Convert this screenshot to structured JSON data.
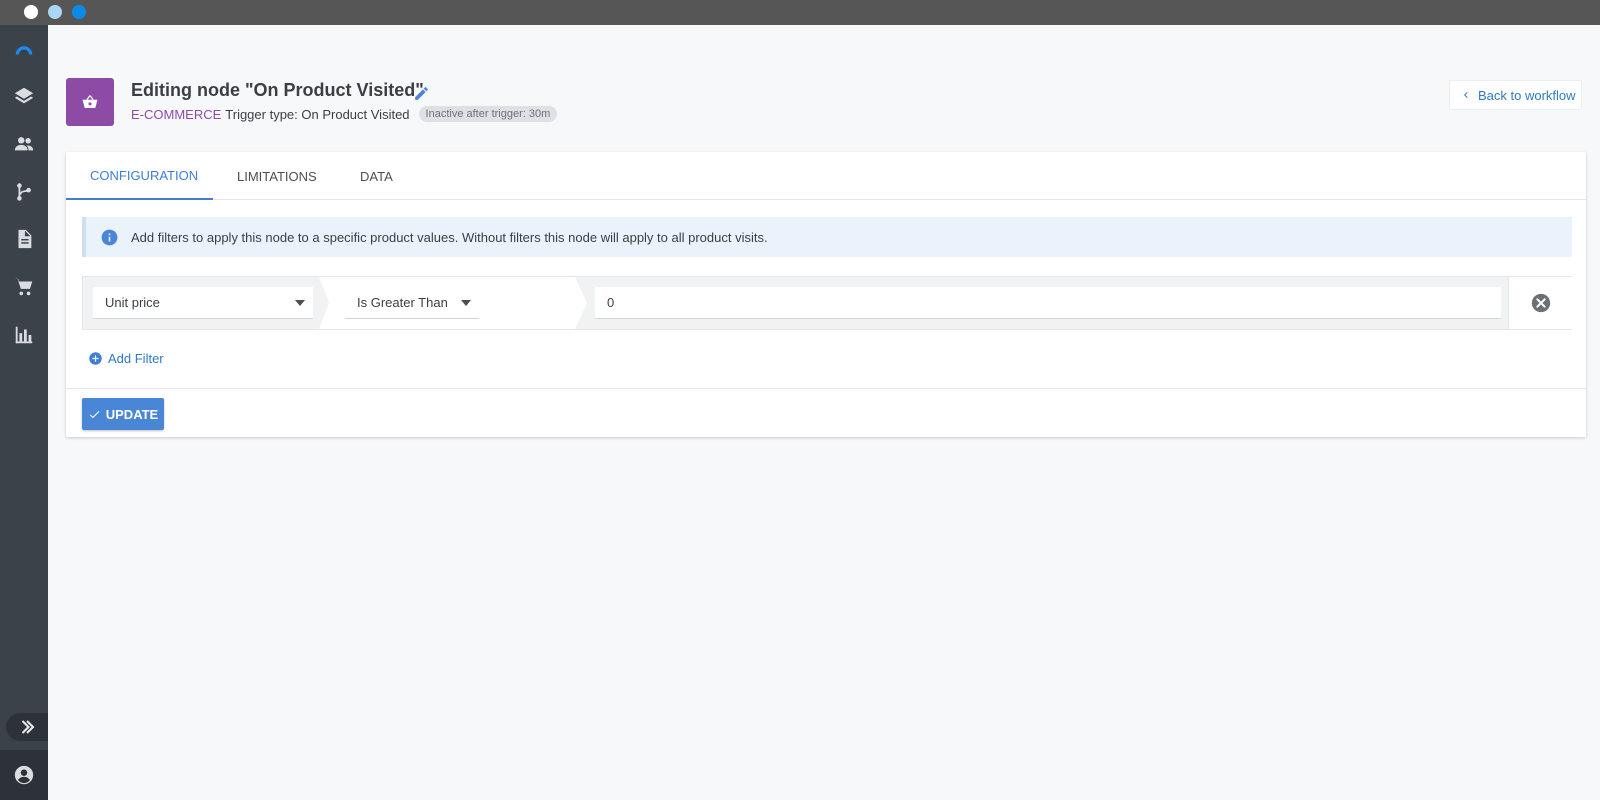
{
  "window": {
    "title_bar_buttons": [
      "close",
      "minimize",
      "maximize"
    ]
  },
  "sidebar": {
    "items": [
      {
        "icon": "logo-arc-icon"
      },
      {
        "icon": "layers-icon"
      },
      {
        "icon": "people-icon"
      },
      {
        "icon": "workflow-branch-icon"
      },
      {
        "icon": "document-icon"
      },
      {
        "icon": "cart-icon"
      },
      {
        "icon": "bar-chart-icon"
      }
    ],
    "collapse_icon": "double-chevron-right-icon",
    "account_icon": "account-circle-icon"
  },
  "header": {
    "title": "Editing node \"On Product Visited\"",
    "category": "E-COMMERCE",
    "trigger_type": "Trigger type: On Product Visited",
    "badge": "Inactive after trigger: 30m",
    "back_label": "Back to workflow",
    "node_icon": "basket-icon",
    "accent_color": "#8e4ba6"
  },
  "tabs": [
    {
      "label": "CONFIGURATION",
      "active": true
    },
    {
      "label": "LIMITATIONS",
      "active": false
    },
    {
      "label": "DATA",
      "active": false
    }
  ],
  "info": {
    "text": "Add filters to apply this node to a specific product values. Without filters this node will apply to all product visits."
  },
  "filters": [
    {
      "field": "Unit price",
      "operator": "Is Greater Than",
      "value": "0"
    }
  ],
  "add_filter_label": "Add Filter",
  "update_label": "UPDATE",
  "colors": {
    "primary": "#4a86d6",
    "sidebar": "#3b4249",
    "titlebar": "#565656"
  }
}
